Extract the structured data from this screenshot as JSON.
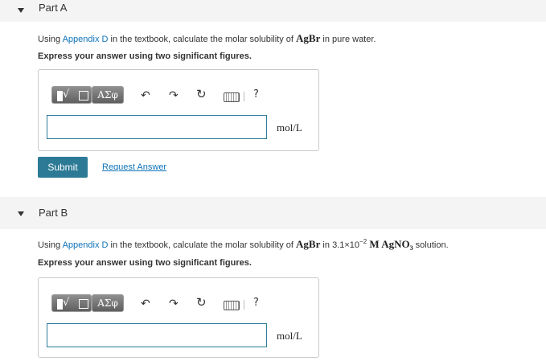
{
  "colors": {
    "link": "#0d73b9",
    "submit_bg": "#2c7a96",
    "input_border": "#2d7d9a",
    "header_bg": "#f4f4f4"
  },
  "partA": {
    "title": "Part A",
    "prompt_pre": "Using ",
    "appendix_link": "Appendix D",
    "prompt_mid": " in the textbook, calculate the molar solubility of ",
    "compound": "AgBr",
    "prompt_post": " in pure water.",
    "instruction": "Express your answer using two significant figures.",
    "toolbar": {
      "greek_label": "ΑΣφ",
      "help_label": "?"
    },
    "answer_value": "",
    "unit": "mol/L",
    "submit_label": "Submit",
    "request_label": "Request Answer"
  },
  "partB": {
    "title": "Part B",
    "prompt_pre": "Using ",
    "appendix_link": "Appendix D",
    "prompt_mid": " in the textbook, calculate the molar solubility of ",
    "compound": "AgBr",
    "prompt_in": " in ",
    "conc_mantissa": "3.1×10",
    "conc_exp": "−2",
    "conc_unit": " M ",
    "solute": "AgNO",
    "solute_sub": "3",
    "prompt_post": " solution.",
    "instruction": "Express your answer using two significant figures.",
    "toolbar": {
      "greek_label": "ΑΣφ",
      "help_label": "?"
    },
    "answer_value": "",
    "unit": "mol/L"
  }
}
